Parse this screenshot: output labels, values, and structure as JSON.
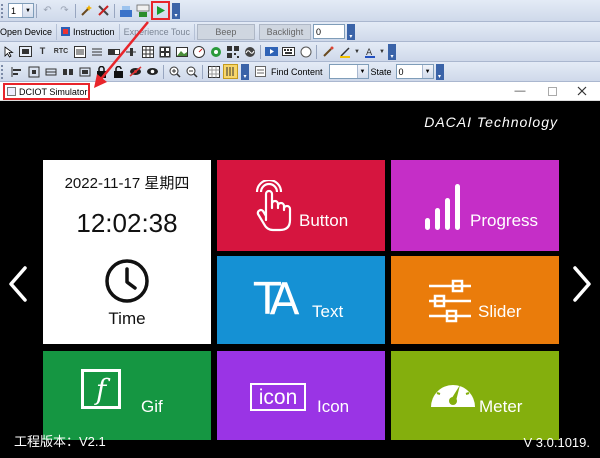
{
  "toolbar1": {
    "page_select": "1"
  },
  "toolbar2": {
    "open_device": "Open Device",
    "instruction": "Instruction",
    "experience_touch": "Experience Touc",
    "beep": "Beep",
    "backlight": "Backlight",
    "backlight_value": "0"
  },
  "toolbar4": {
    "find_content_label": "Find Content",
    "find_content_value": "",
    "state_label": "State",
    "state_value": "0"
  },
  "window": {
    "title": "DCIOT Simulator"
  },
  "screen": {
    "brand": "DACAI Technology",
    "date": "2022-11-17 星期四",
    "clock": "12:02:38",
    "time_label": "Time",
    "tiles": {
      "button": "Button",
      "progress": "Progress",
      "text": "Text",
      "slider": "Slider",
      "gif": "Gif",
      "icon": "Icon",
      "meter": "Meter"
    },
    "text_tile_glyph": "TA",
    "icon_tile_glyph": "icon",
    "gif_tile_glyph": "f",
    "project_version": "工程版本：V2.1",
    "firmware_version": "V 3.0.1019."
  },
  "colors": {
    "button_tile": "#d6153f",
    "progress_tile": "#c52ec7",
    "text_tile": "#1591d4",
    "slider_tile": "#ea7c0b",
    "gif_tile": "#159642",
    "icon_tile": "#9a34e5",
    "meter_tile": "#84af0d",
    "annotation": "#e8252b"
  }
}
